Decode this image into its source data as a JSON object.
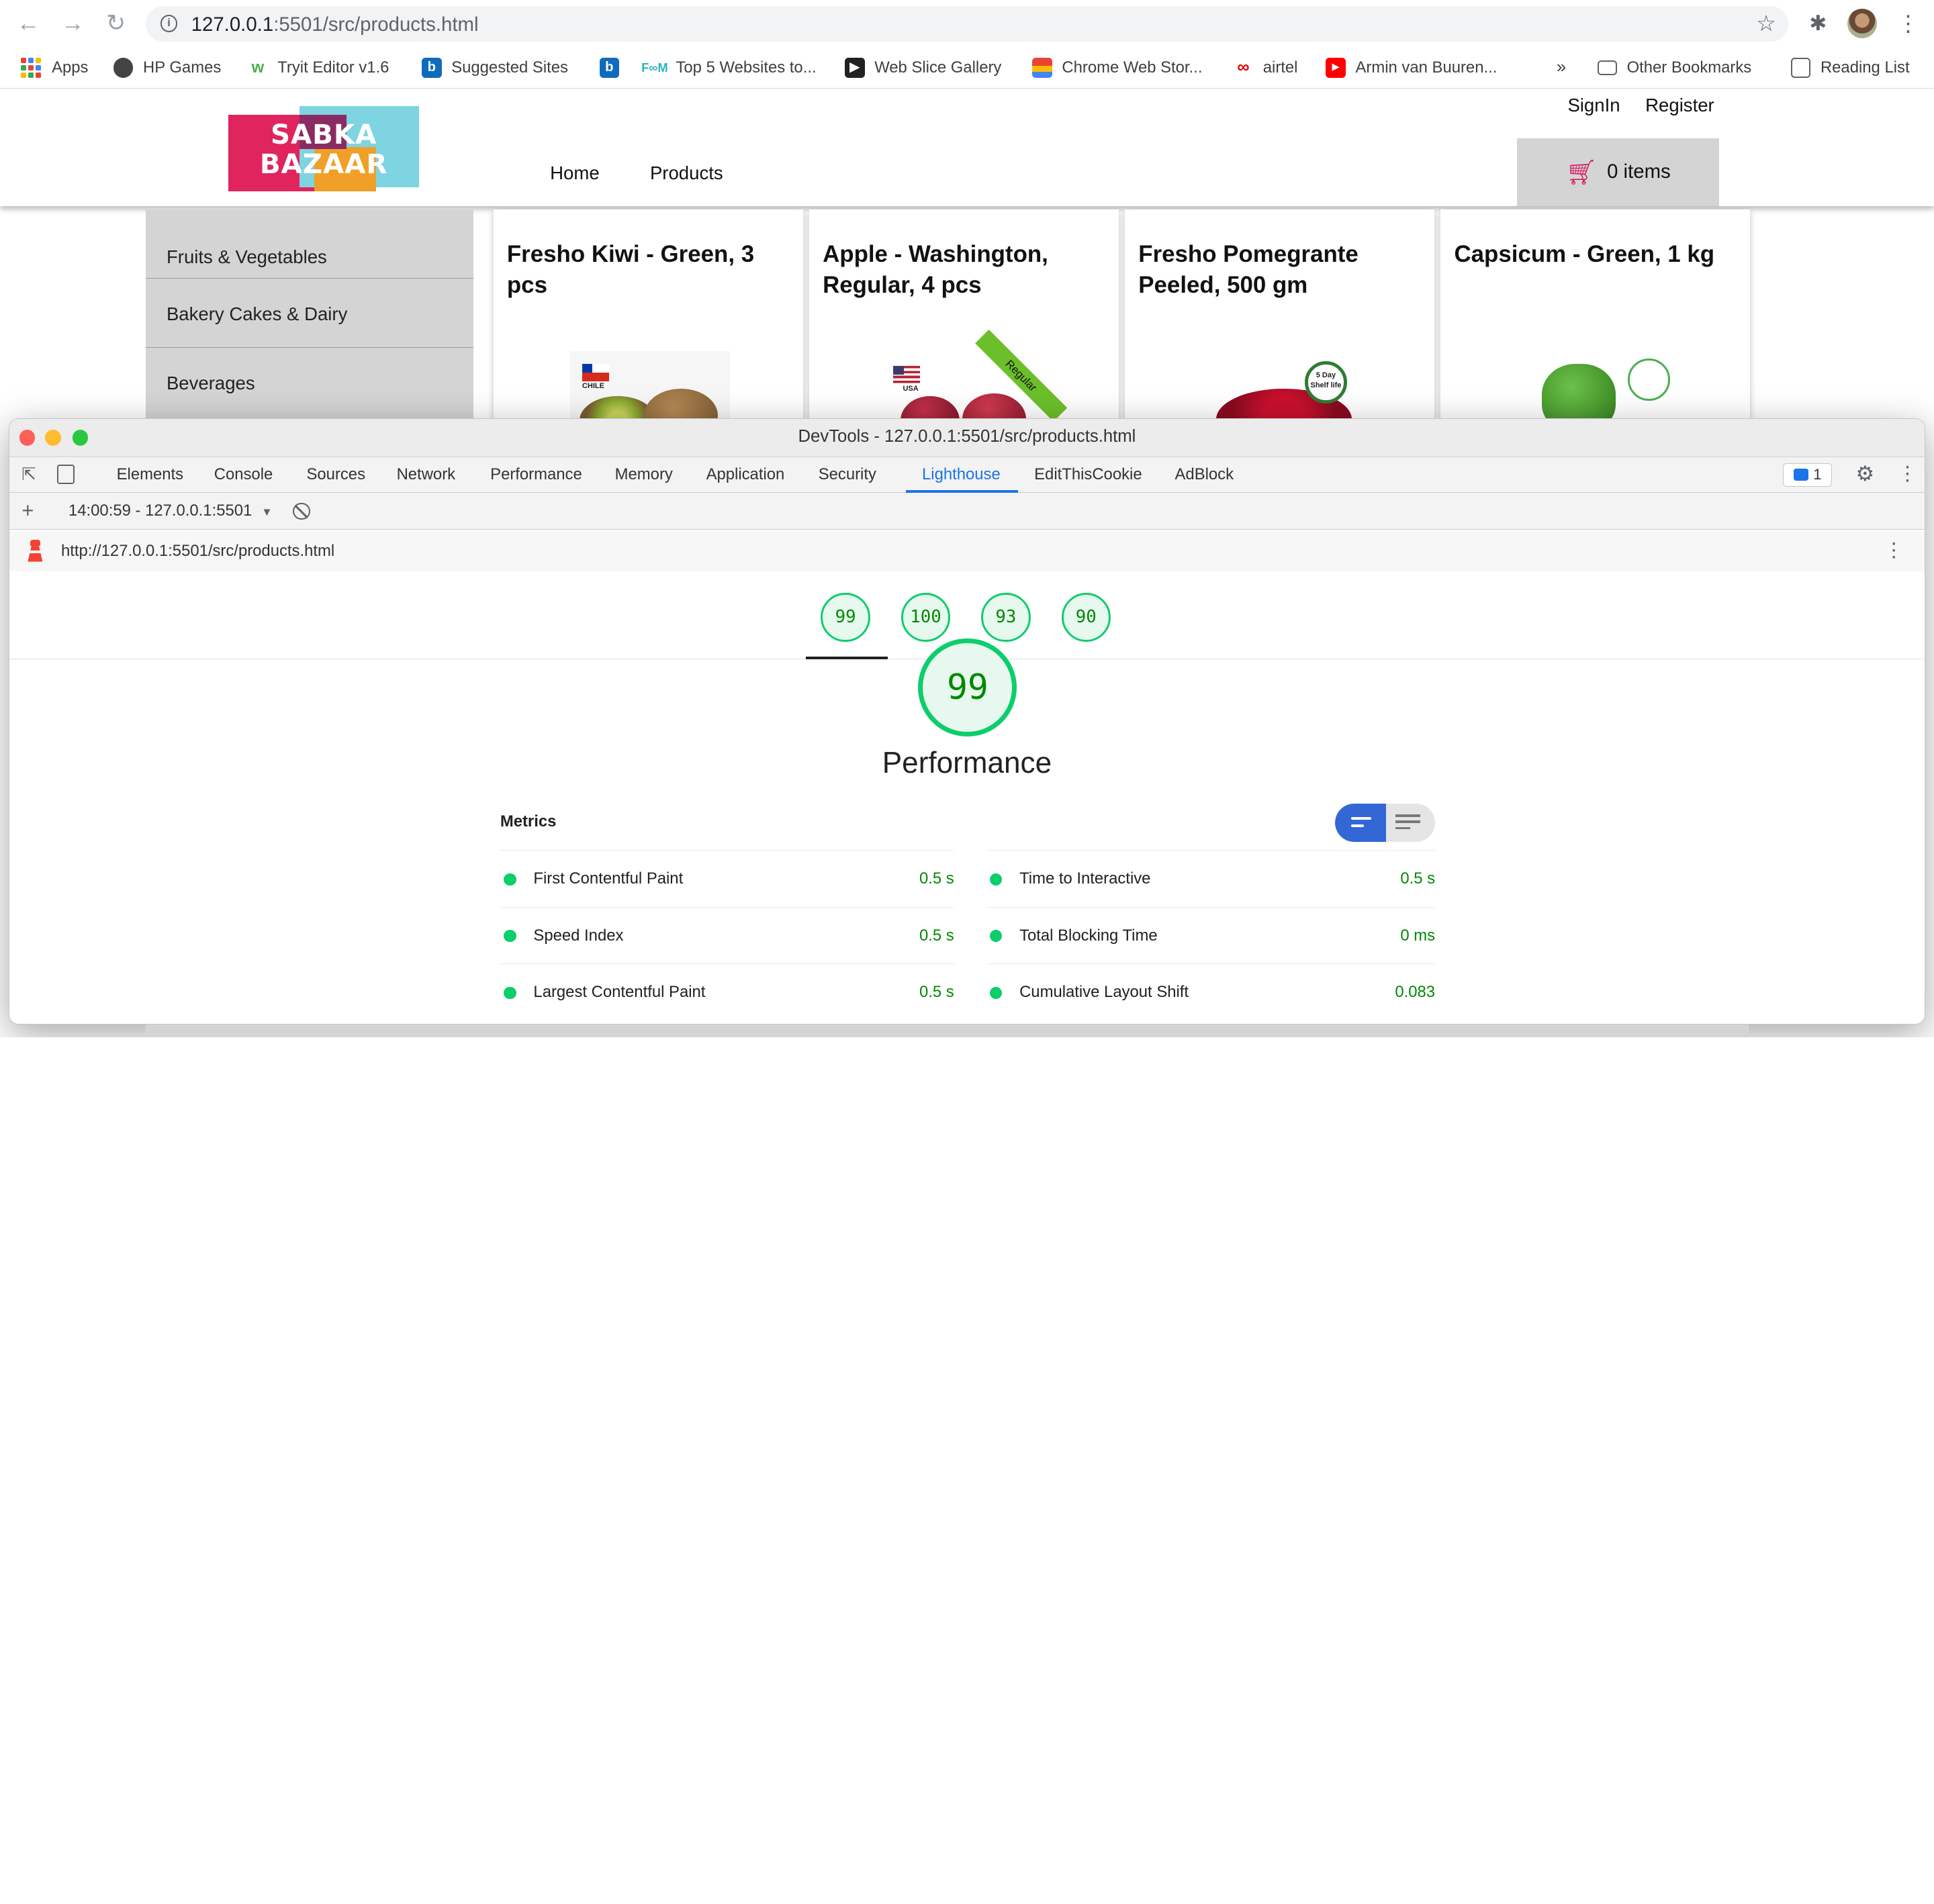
{
  "browser": {
    "url_host": "127.0.0.1",
    "url_rest": ":5501/src/products.html",
    "bookmarks": [
      {
        "label": "Apps"
      },
      {
        "label": "HP Games"
      },
      {
        "label": "Tryit Editor v1.6"
      },
      {
        "label": "Suggested Sites"
      },
      {
        "label": ""
      },
      {
        "label": "Top 5 Websites to..."
      },
      {
        "label": "Web Slice Gallery"
      },
      {
        "label": "Chrome Web Stor..."
      },
      {
        "label": "airtel"
      },
      {
        "label": "Armin van Buuren..."
      }
    ],
    "overflow": "»",
    "other_bookmarks": "Other Bookmarks",
    "reading_list": "Reading List"
  },
  "site": {
    "logo_line1": "SABKA",
    "logo_line2": "BAZAAR",
    "nav": {
      "home": "Home",
      "products": "Products"
    },
    "signin": "SignIn",
    "register": "Register",
    "cart_label": "0 items",
    "categories": [
      "Fruits & Vegetables",
      "Bakery Cakes & Dairy",
      "Beverages"
    ],
    "products": [
      {
        "title": "Fresho Kiwi - Green, 3 pcs",
        "flag_label": "CHILE"
      },
      {
        "title": "Apple - Washington, Regular, 4 pcs",
        "flag_label": "USA",
        "ribbon": "Regular"
      },
      {
        "title": "Fresho Pomegrante Peeled, 500 gm",
        "badge": "5 Day Shelf life"
      },
      {
        "title": "Capsicum - Green, 1 kg"
      }
    ]
  },
  "devtools": {
    "title": "DevTools - 127.0.0.1:5501/src/products.html",
    "tabs": [
      "Elements",
      "Console",
      "Sources",
      "Network",
      "Performance",
      "Memory",
      "Application",
      "Security",
      "Lighthouse",
      "EditThisCookie",
      "AdBlock"
    ],
    "active_tab": "Lighthouse",
    "issues_count": "1",
    "report_select": "14:00:59 - 127.0.0.1:5501",
    "report_url": "http://127.0.0.1:5501/src/products.html",
    "scores": [
      "99",
      "100",
      "93",
      "90"
    ],
    "main_score": "99",
    "category": "Performance",
    "metrics_heading": "Metrics",
    "metrics": [
      {
        "name": "First Contentful Paint",
        "value": "0.5 s"
      },
      {
        "name": "Time to Interactive",
        "value": "0.5 s"
      },
      {
        "name": "Speed Index",
        "value": "0.5 s"
      },
      {
        "name": "Total Blocking Time",
        "value": "0 ms"
      },
      {
        "name": "Largest Contentful Paint",
        "value": "0.5 s"
      },
      {
        "name": "Cumulative Layout Shift",
        "value": "0.083"
      }
    ]
  },
  "colors": {
    "lighthouse_pass": "#0cce6b",
    "devtools_accent": "#1a73e8",
    "brand_pink": "#e0245e",
    "brand_teal": "#7fd4e2"
  }
}
